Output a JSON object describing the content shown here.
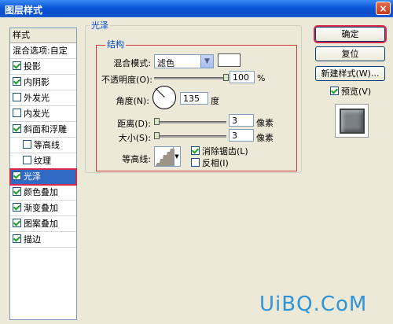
{
  "window": {
    "title": "图层样式",
    "close_glyph": "×"
  },
  "style_list": {
    "header": "样式",
    "blend_options": "混合选项:自定",
    "items": [
      {
        "label": "投影",
        "checked": true,
        "indent": false,
        "selected": false
      },
      {
        "label": "内阴影",
        "checked": true,
        "indent": false,
        "selected": false
      },
      {
        "label": "外发光",
        "checked": false,
        "indent": false,
        "selected": false
      },
      {
        "label": "内发光",
        "checked": false,
        "indent": false,
        "selected": false
      },
      {
        "label": "斜面和浮雕",
        "checked": true,
        "indent": false,
        "selected": false
      },
      {
        "label": "等高线",
        "checked": false,
        "indent": true,
        "selected": false
      },
      {
        "label": "纹理",
        "checked": false,
        "indent": true,
        "selected": false
      },
      {
        "label": "光泽",
        "checked": true,
        "indent": false,
        "selected": true
      },
      {
        "label": "颜色叠加",
        "checked": true,
        "indent": false,
        "selected": false
      },
      {
        "label": "渐变叠加",
        "checked": true,
        "indent": false,
        "selected": false
      },
      {
        "label": "图案叠加",
        "checked": true,
        "indent": false,
        "selected": false
      },
      {
        "label": "描边",
        "checked": true,
        "indent": false,
        "selected": false
      }
    ]
  },
  "satin": {
    "group_title": "光泽",
    "structure_title": "结构",
    "blend_mode_label": "混合模式:",
    "blend_mode_value": "滤色",
    "blend_color": "#ffffff",
    "opacity_label": "不透明度(O):",
    "opacity_value": "100",
    "opacity_unit": "%",
    "opacity_level": 1.0,
    "angle_label": "角度(N):",
    "angle_value": "135",
    "angle_unit": "度",
    "distance_label": "距离(D):",
    "distance_value": "3",
    "distance_unit": "像素",
    "size_label": "大小(S):",
    "size_value": "3",
    "size_unit": "像素",
    "contour_label": "等高线:",
    "anti_alias_label": "消除锯齿(L)",
    "anti_alias_checked": true,
    "invert_label": "反相(I)",
    "invert_checked": false
  },
  "buttons": {
    "ok": "确定",
    "reset": "复位",
    "new_style": "新建样式(W)...",
    "preview_label": "预览(V)",
    "preview_checked": true
  },
  "watermark": "UiBQ.CoM"
}
